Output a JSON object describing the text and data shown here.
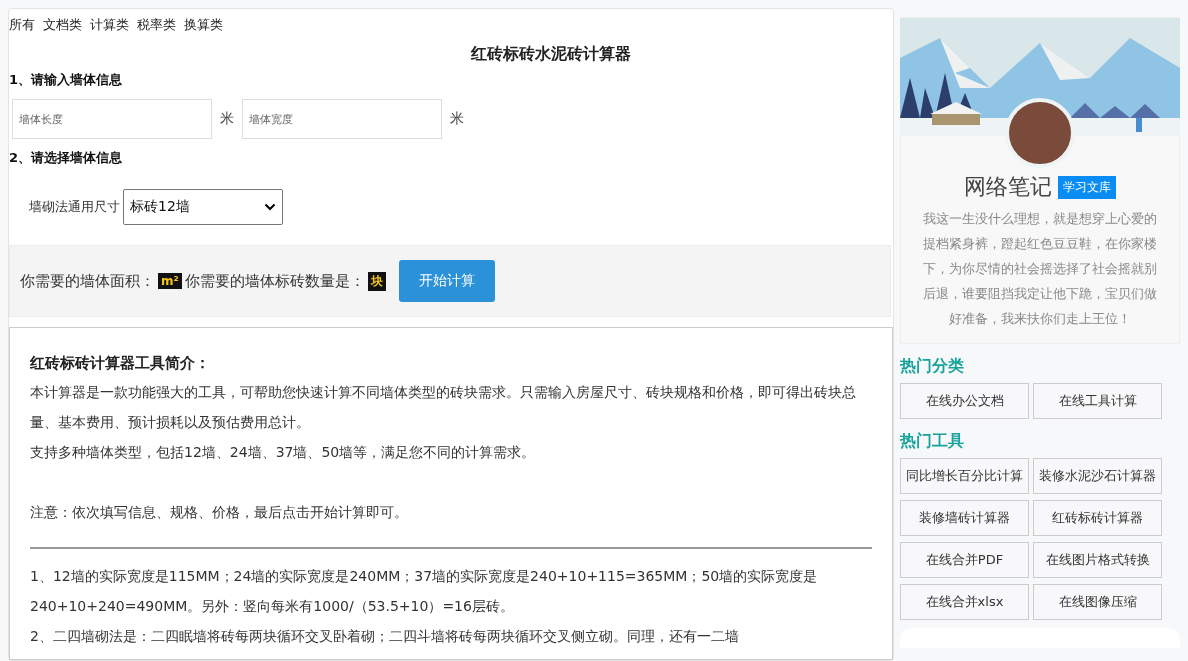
{
  "nav": [
    {
      "label": "所有"
    },
    {
      "label": "文档类"
    },
    {
      "label": "计算类"
    },
    {
      "label": "税率类"
    },
    {
      "label": "换算类"
    }
  ],
  "title": "红砖标砖水泥砖计算器",
  "section1": "1、请输入墙体信息",
  "inputs": [
    {
      "placeholder": "墙体长度",
      "unit": "米"
    },
    {
      "placeholder": "墙体宽度",
      "unit": "米"
    }
  ],
  "section2": "2、请选择墙体信息",
  "select": {
    "label": "墙砌法通用尺寸",
    "value": "标砖12墙"
  },
  "result": {
    "area_label": "你需要的墙体面积：",
    "area_unit": "m²",
    "count_label": "你需要的墙体标砖数量是：",
    "count_unit": "块",
    "button": "开始计算"
  },
  "intro": {
    "heading": "红砖标砖计算器工具简介：",
    "paragraphs": [
      "本计算器是一款功能强大的工具，可帮助您快速计算不同墙体类型的砖块需求。只需输入房屋尺寸、砖块规格和价格，即可得出砖块总量、基本费用、预计损耗以及预估费用总计。",
      "支持多种墙体类型，包括12墙、24墙、37墙、50墙等，满足您不同的计算需求。"
    ],
    "note": "注意：依次填写信息、规格、价格，最后点击开始计算即可。",
    "notes": [
      "1、12墙的实际宽度是115MM；24墙的实际宽度是240MM；37墙的实际宽度是240+10+115=365MM；50墙的实际宽度是240+10+240=490MM。另外：竖向每米有1000/（53.5+10）=16层砖。",
      "2、二四墙砌法是：二四眠墙将砖每两块循环交叉卧着砌；二四斗墙将砖每两块循环交叉侧立砌。同理，还有一二墙"
    ]
  },
  "profile": {
    "name": "网络笔记",
    "badge": "学习文库",
    "bio": "我这一生没什么理想，就是想穿上心爱的提档紧身裤，蹬起红色豆豆鞋，在你家楼下，为你尽情的社会摇选择了社会摇就别后退，谁要阻挡我定让他下跪，宝贝们做好准备，我来扶你们走上王位！"
  },
  "hot_categories": {
    "title": "热门分类",
    "items": [
      "在线办公文档",
      "在线工具计算"
    ]
  },
  "hot_tools": {
    "title": "热门工具",
    "items": [
      "同比增长百分比计算",
      "装修水泥沙石计算器",
      "装修墙砖计算器",
      "红砖标砖计算器",
      "在线合并PDF",
      "在线图片格式转换",
      "在线合并xlsx",
      "在线图像压缩"
    ]
  }
}
